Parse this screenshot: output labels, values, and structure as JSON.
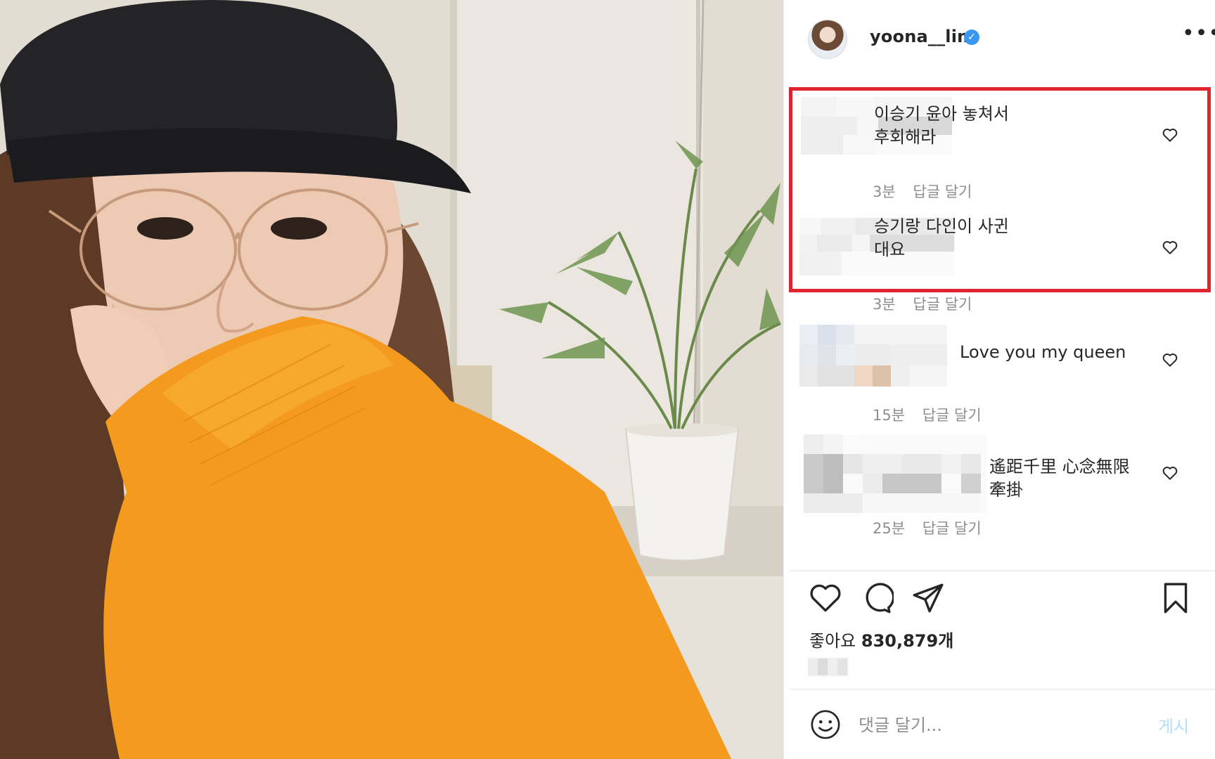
{
  "post": {
    "username": "yoona__lim",
    "verified_icon": "verified-badge-icon",
    "more_icon": "more-options-icon",
    "verified_mark": "✓",
    "more_glyph": "•••"
  },
  "comments": [
    {
      "text": "이승기 윤아 놓쳐서\n후회해라",
      "time": "3분",
      "reply": "답글 달기"
    },
    {
      "text": "승기랑 다인이 사귄\n대요",
      "time": "3분",
      "reply": "답글 달기"
    },
    {
      "text": "Love you my queen",
      "time": "15분",
      "reply": "답글 달기"
    },
    {
      "text": "遙距千里 心念無限\n牽掛",
      "time": "25분",
      "reply": "답글 달기"
    }
  ],
  "likes": {
    "label": "좋아요",
    "count": "830,879개"
  },
  "composer": {
    "placeholder": "댓글 달기...",
    "post_label": "게시"
  },
  "colors": {
    "highlight": "#e0232c",
    "accent": "#3897f0",
    "post_disabled": "#b2dffc"
  }
}
